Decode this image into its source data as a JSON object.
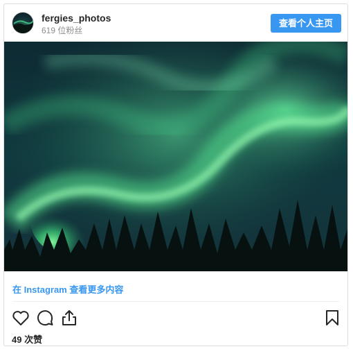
{
  "header": {
    "username": "fergies_photos",
    "followers": "619 位粉丝",
    "view_profile_label": "查看个人主页"
  },
  "post": {
    "view_more_label": "在 Instagram 查看更多内容",
    "likes": "49 次赞"
  },
  "icons": {
    "like": "heart-icon",
    "comment": "comment-icon",
    "share": "share-icon",
    "save": "bookmark-icon"
  },
  "colors": {
    "accent": "#3897f0",
    "text": "#262626",
    "muted": "#8e8e8e"
  }
}
